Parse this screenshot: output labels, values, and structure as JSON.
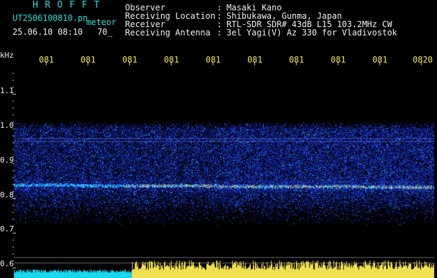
{
  "header": {
    "logo": "H R O F F T",
    "filename": "UT2506100810.pn",
    "kind": "meteor",
    "datetime": "25.06.10 08:10",
    "count": "70_"
  },
  "info": {
    "rows": [
      {
        "label": "Observer",
        "sep": ":",
        "value": "Masaki Kano"
      },
      {
        "label": "Receiving Location",
        "sep": ":",
        "value": "Shibukawa, Gunma, Japan"
      },
      {
        "label": "Receiver",
        "sep": ":",
        "value": "RTL-SDR SDR# 43dB L15 103.2MHz CW"
      },
      {
        "label": "Receiving Antenna",
        "sep": ":",
        "value": "3el Yagi(V) Az 330 for Vladivostok"
      }
    ]
  },
  "axis": {
    "unit": "kHz",
    "y_ticks": [
      "1.1",
      "1.0",
      "0.9",
      "0.8",
      "0.7",
      "0.6"
    ],
    "x_ticks": [
      "081",
      "081",
      "081",
      "081",
      "081",
      "081",
      "081",
      "081",
      "081",
      "0820"
    ]
  },
  "colors": {
    "background": "#000000",
    "signal_low": "#1a2cd8",
    "signal_mid": "#29b8ff",
    "signal_high": "#ffe14a",
    "logo": "#22e0e0",
    "ticks": "#f4e84a"
  }
}
